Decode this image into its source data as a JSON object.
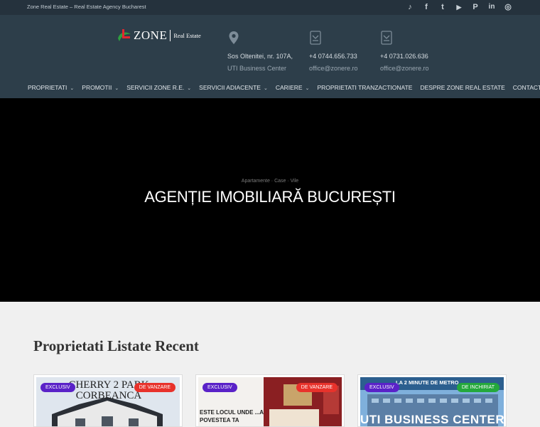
{
  "topbar": {
    "tagline": "Zone Real Estate – Real Estate Agency Bucharest",
    "social": [
      {
        "icon": "tiktok-icon",
        "glyph": "♪"
      },
      {
        "icon": "facebook-icon",
        "glyph": "f"
      },
      {
        "icon": "twitter-icon",
        "glyph": "t"
      },
      {
        "icon": "youtube-icon",
        "glyph": "▶"
      },
      {
        "icon": "pinterest-icon",
        "glyph": "P"
      },
      {
        "icon": "linkedin-icon",
        "glyph": "in"
      },
      {
        "icon": "instagram-icon",
        "glyph": "◎"
      }
    ]
  },
  "header": {
    "logo_text": "ZONE",
    "logo_sub": "Real Estate",
    "address": {
      "line1": "Sos Oltenitei, nr. 107A,",
      "line2": "UTI Business Center"
    },
    "contact1": {
      "phone": "+4 0744.656.733",
      "email": "office@zonere.ro"
    },
    "contact2": {
      "phone": "+4 0731.026.636",
      "email": "office@zonere.ro"
    }
  },
  "nav": {
    "items": [
      {
        "label": "PROPRIETATI",
        "dropdown": true
      },
      {
        "label": "PROMOTII",
        "dropdown": true
      },
      {
        "label": "SERVICII ZONE R.E.",
        "dropdown": true
      },
      {
        "label": "SERVICII ADIACENTE",
        "dropdown": true
      },
      {
        "label": "CARIERE",
        "dropdown": true
      },
      {
        "label": "PROPRIETATI TRANZACTIONATE",
        "dropdown": false
      },
      {
        "label": "DESPRE ZONE REAL ESTATE",
        "dropdown": false
      },
      {
        "label": "CONTACT",
        "dropdown": false
      }
    ]
  },
  "hero": {
    "subtitle": "Apartamente · Case · Vile",
    "title": "AGENȚIE IMOBILIARĂ BUCUREȘTI"
  },
  "listings": {
    "title": "Proprietati Listate Recent",
    "cards": [
      {
        "badge": "EXCLUSIV",
        "status": "DE VANZARE",
        "status_color": "red",
        "image_text": "CHERRY 2 PARK CORBEANCA"
      },
      {
        "badge": "EXCLUSIV",
        "status": "DE VANZARE",
        "status_color": "red",
        "image_text": "ESTE LOCUL UNDE ...A POVESTEA TA"
      },
      {
        "badge": "EXCLUSIV",
        "status": "DE INCHIRIAT",
        "status_color": "green",
        "image_text": "UTI BUSINESS CENTER",
        "image_banner": "LA 2 MINUTE DE METRO"
      }
    ]
  }
}
